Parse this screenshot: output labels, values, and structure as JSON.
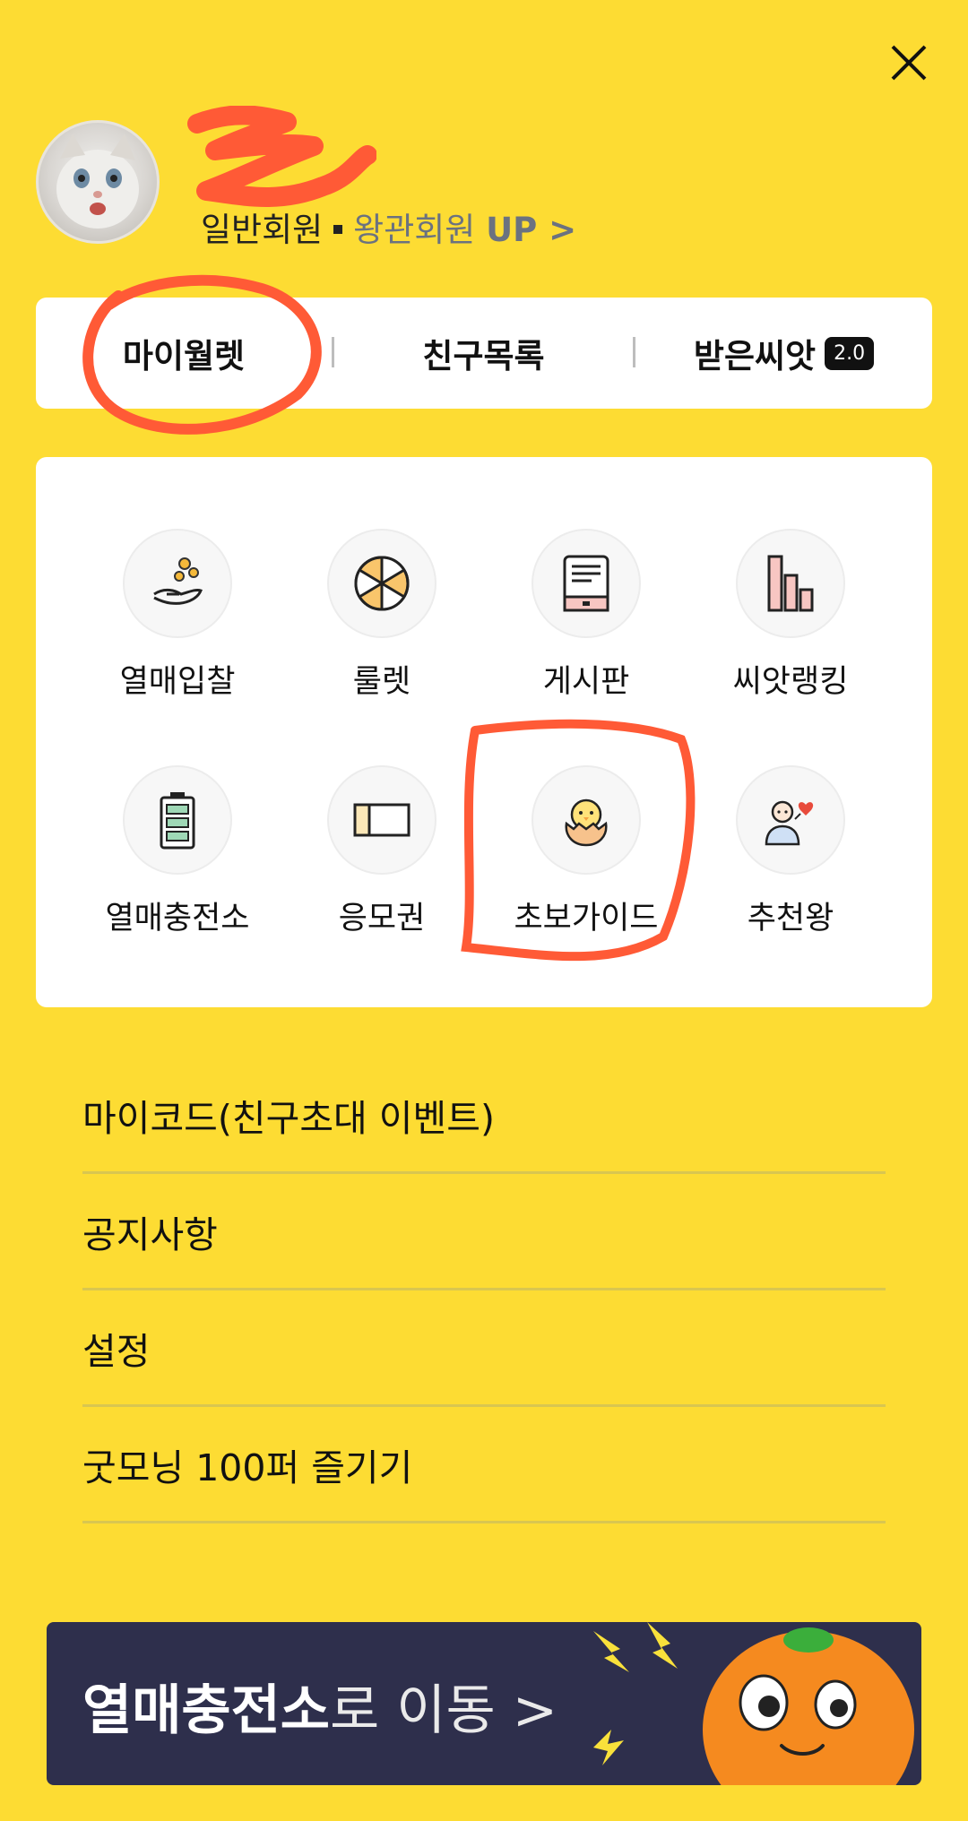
{
  "profile": {
    "grade": "일반회원",
    "upgrade_text": "왕관회원",
    "upgrade_strong": "UP >"
  },
  "tabs": [
    {
      "label": "마이월렛"
    },
    {
      "label": "친구목록"
    },
    {
      "label": "받은씨앗",
      "badge": "2.0"
    }
  ],
  "grid": [
    {
      "label": "열매입찰",
      "icon": "coin-hand-icon"
    },
    {
      "label": "룰렛",
      "icon": "roulette-icon"
    },
    {
      "label": "게시판",
      "icon": "board-icon"
    },
    {
      "label": "씨앗랭킹",
      "icon": "ranking-bars-icon"
    },
    {
      "label": "열매충전소",
      "icon": "battery-icon"
    },
    {
      "label": "응모권",
      "icon": "ticket-icon"
    },
    {
      "label": "초보가이드",
      "icon": "chick-egg-icon"
    },
    {
      "label": "추천왕",
      "icon": "person-heart-icon"
    }
  ],
  "menu": [
    {
      "label": "마이코드(친구초대 이벤트)"
    },
    {
      "label": "공지사항"
    },
    {
      "label": "설정"
    },
    {
      "label": "굿모닝 100퍼 즐기기"
    }
  ],
  "banner": {
    "strong": "열매충전소",
    "rest": "로 이동 >"
  },
  "colors": {
    "background": "#FDDC33",
    "banner": "#2e2f4c",
    "annotation": "#FF5A36"
  }
}
